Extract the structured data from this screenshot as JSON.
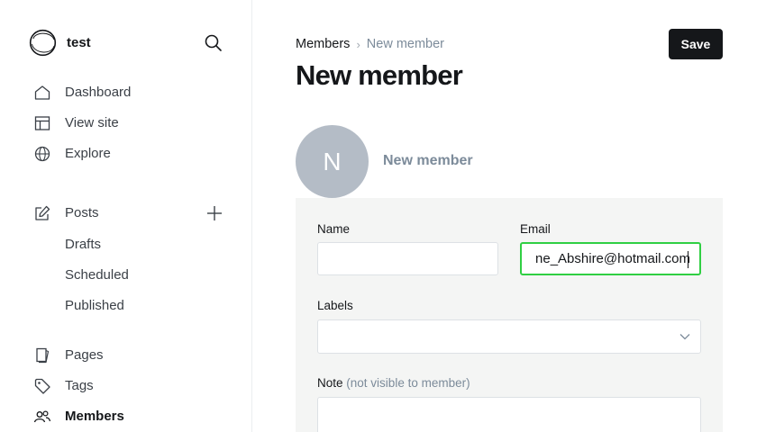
{
  "app": {
    "site_name": "test"
  },
  "sidebar": {
    "nav": [
      {
        "label": "Dashboard",
        "icon": "home-icon"
      },
      {
        "label": "View site",
        "icon": "layout-icon"
      },
      {
        "label": "Explore",
        "icon": "globe-icon"
      }
    ],
    "posts": {
      "label": "Posts",
      "icon": "edit-icon",
      "subitems": [
        "Drafts",
        "Scheduled",
        "Published"
      ]
    },
    "secondary": [
      {
        "label": "Pages",
        "icon": "pages-icon"
      },
      {
        "label": "Tags",
        "icon": "tag-icon"
      },
      {
        "label": "Members",
        "icon": "members-icon",
        "active": true
      }
    ]
  },
  "header": {
    "breadcrumb": {
      "parent": "Members",
      "separator": "›",
      "current": "New member"
    },
    "title": "New member",
    "save_label": "Save"
  },
  "member": {
    "avatar_initial": "N",
    "display_name": "New member"
  },
  "form": {
    "name": {
      "label": "Name",
      "value": ""
    },
    "email": {
      "label": "Email",
      "value": "ne_Abshire@hotmail.com",
      "focused": true
    },
    "labels": {
      "label": "Labels",
      "value": ""
    },
    "note": {
      "label": "Note",
      "hint": "(not visible to member)",
      "value": ""
    }
  },
  "colors": {
    "accent_focus": "#30cf43",
    "primary_button": "#15171a",
    "avatar_bg": "#b4bcc6",
    "form_bg": "#f4f5f4"
  }
}
